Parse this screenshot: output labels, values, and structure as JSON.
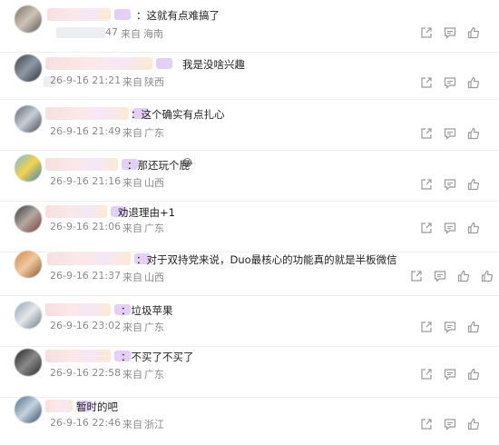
{
  "comments": [
    {
      "text": "：这就有点难搞了",
      "time": "47",
      "from_label": "来自",
      "region": "海南"
    },
    {
      "text": "我是没啥兴趣",
      "time": "26-9-16 21:21",
      "from_label": "来自",
      "region": "陕西"
    },
    {
      "text": "：这个确实有点扎心",
      "time": "26-9-16 21:49",
      "from_label": "来自",
      "region": "广东"
    },
    {
      "text": "：那还玩个屁",
      "time": "26-9-16 21:16",
      "from_label": "来自",
      "region": "山西"
    },
    {
      "text": "劝退理由+1",
      "time": "26-9-16 21:06",
      "from_label": "来自",
      "region": "广东"
    },
    {
      "text": "：对于双持党来说，Duo最核心的功能真的就是半板微信",
      "time": "26-9-16 21:37",
      "from_label": "来自",
      "region": "山西"
    },
    {
      "text": "：垃圾苹果",
      "time": "26-9-16 23:02",
      "from_label": "来自",
      "region": "广东"
    },
    {
      "text": "：不买了不买了",
      "time": "26-9-16 22:58",
      "from_label": "来自",
      "region": "广东"
    },
    {
      "text": "暂时的吧",
      "time": "26-9-16 22:46",
      "from_label": "来自",
      "region": "浙江"
    }
  ],
  "action_icons": [
    "share-icon",
    "comment-icon",
    "like-icon"
  ],
  "colors": {
    "meta": "#8a8a8a",
    "icon": "#9a9a9a"
  }
}
